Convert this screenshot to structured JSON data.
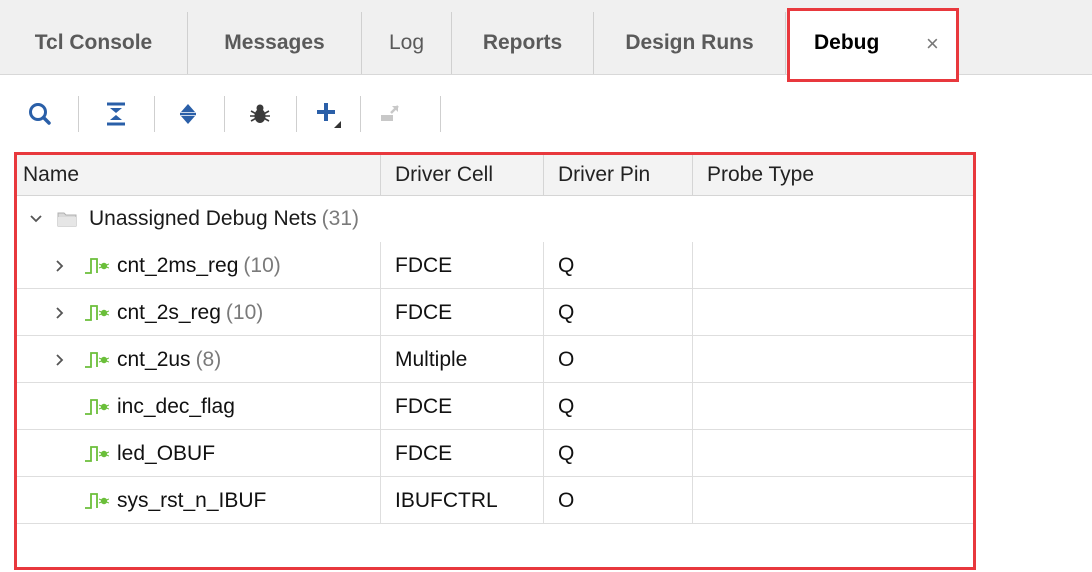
{
  "tabs": [
    {
      "label": "Tcl Console"
    },
    {
      "label": "Messages"
    },
    {
      "label": "Log"
    },
    {
      "label": "Reports"
    },
    {
      "label": "Design Runs"
    }
  ],
  "active_tab": {
    "label": "Debug",
    "close": "×"
  },
  "toolbar": {
    "icons": [
      "search-icon",
      "collapse-all-icon",
      "expand-all-icon",
      "debug-bug-icon",
      "add-icon",
      "disconnect-icon"
    ]
  },
  "table": {
    "columns": [
      "Name",
      "Driver Cell",
      "Driver Pin",
      "Probe Type"
    ],
    "group": {
      "label": "Unassigned Debug Nets",
      "count": "(31)"
    },
    "rows": [
      {
        "name": "cnt_2ms_reg",
        "count": "(10)",
        "expandable": true,
        "driver_cell": "FDCE",
        "driver_pin": "Q",
        "probe_type": ""
      },
      {
        "name": "cnt_2s_reg",
        "count": "(10)",
        "expandable": true,
        "driver_cell": "FDCE",
        "driver_pin": "Q",
        "probe_type": ""
      },
      {
        "name": "cnt_2us",
        "count": "(8)",
        "expandable": true,
        "driver_cell": "Multiple",
        "driver_pin": "O",
        "probe_type": ""
      },
      {
        "name": "inc_dec_flag",
        "count": "",
        "expandable": false,
        "driver_cell": "FDCE",
        "driver_pin": "Q",
        "probe_type": ""
      },
      {
        "name": "led_OBUF",
        "count": "",
        "expandable": false,
        "driver_cell": "FDCE",
        "driver_pin": "Q",
        "probe_type": ""
      },
      {
        "name": "sys_rst_n_IBUF",
        "count": "",
        "expandable": false,
        "driver_cell": "IBUFCTRL",
        "driver_pin": "O",
        "probe_type": ""
      }
    ]
  },
  "colors": {
    "highlight": "#e8383d",
    "net_icon": "#6bbf3a",
    "toolbar_icon": "#2a5fa8"
  }
}
